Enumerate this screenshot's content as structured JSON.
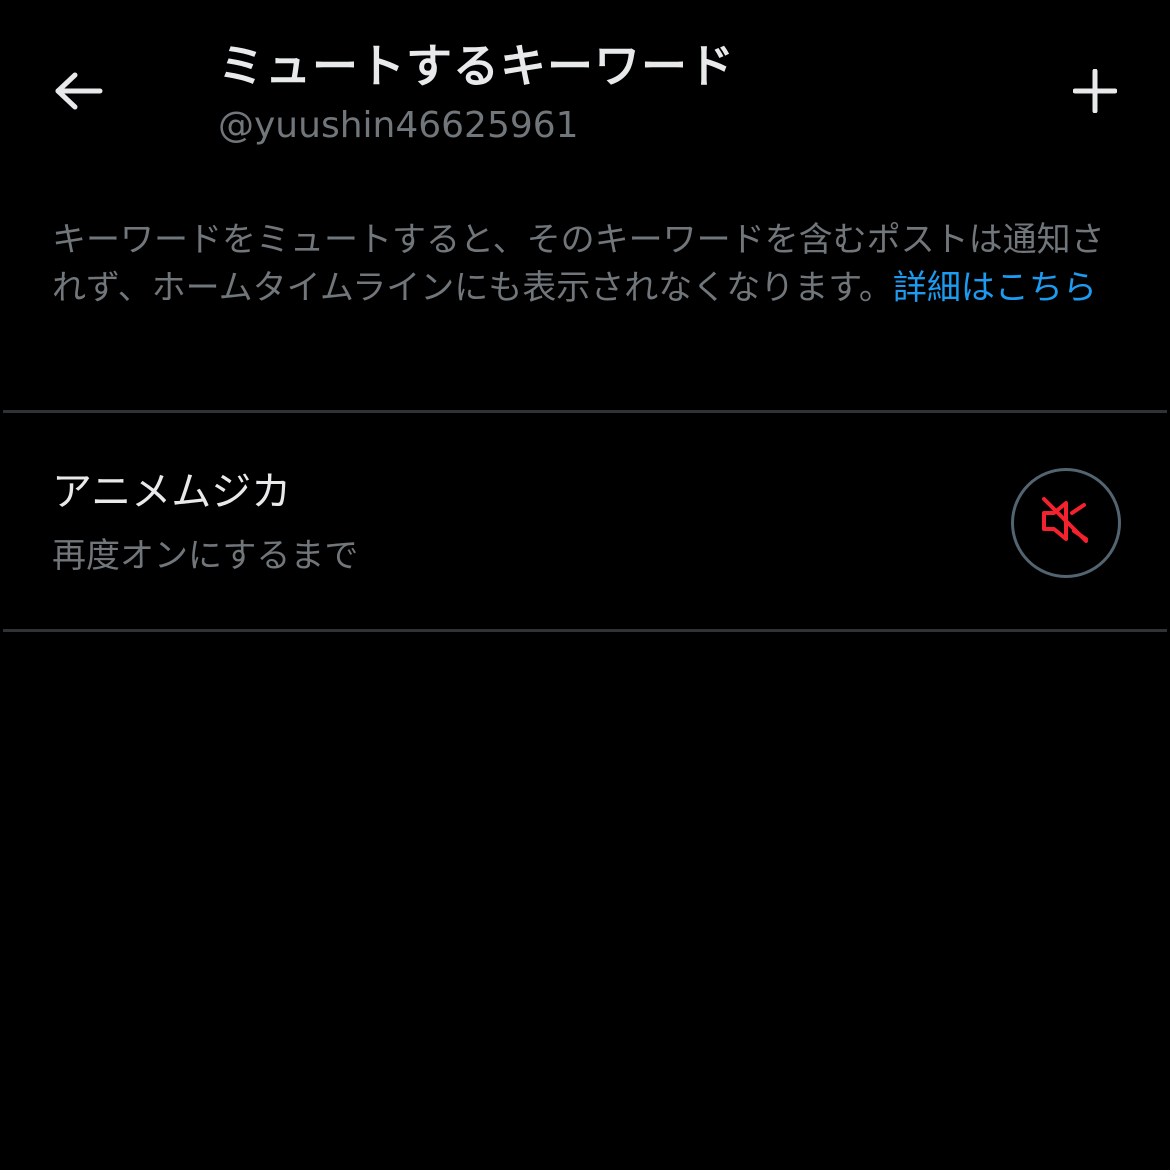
{
  "header": {
    "title": "ミュートするキーワード",
    "handle": "@yuushin46625961",
    "back_icon": "arrow-left-icon",
    "add_icon": "plus-icon"
  },
  "description": {
    "text": "キーワードをミュートすると、そのキーワードを含むポストは通知されず、ホームタイムラインにも表示されなくなります。",
    "link_text": "詳細はこちら"
  },
  "muted_keywords": [
    {
      "keyword": "アニメムジカ",
      "duration": "再度オンにするまで",
      "action_icon": "speaker-muted-icon"
    }
  ],
  "colors": {
    "background": "#000000",
    "primary_text": "#e7e9ea",
    "secondary_text": "#71767b",
    "link": "#1d9bf0",
    "divider": "#2f3336",
    "mute_icon": "#f4212e"
  }
}
